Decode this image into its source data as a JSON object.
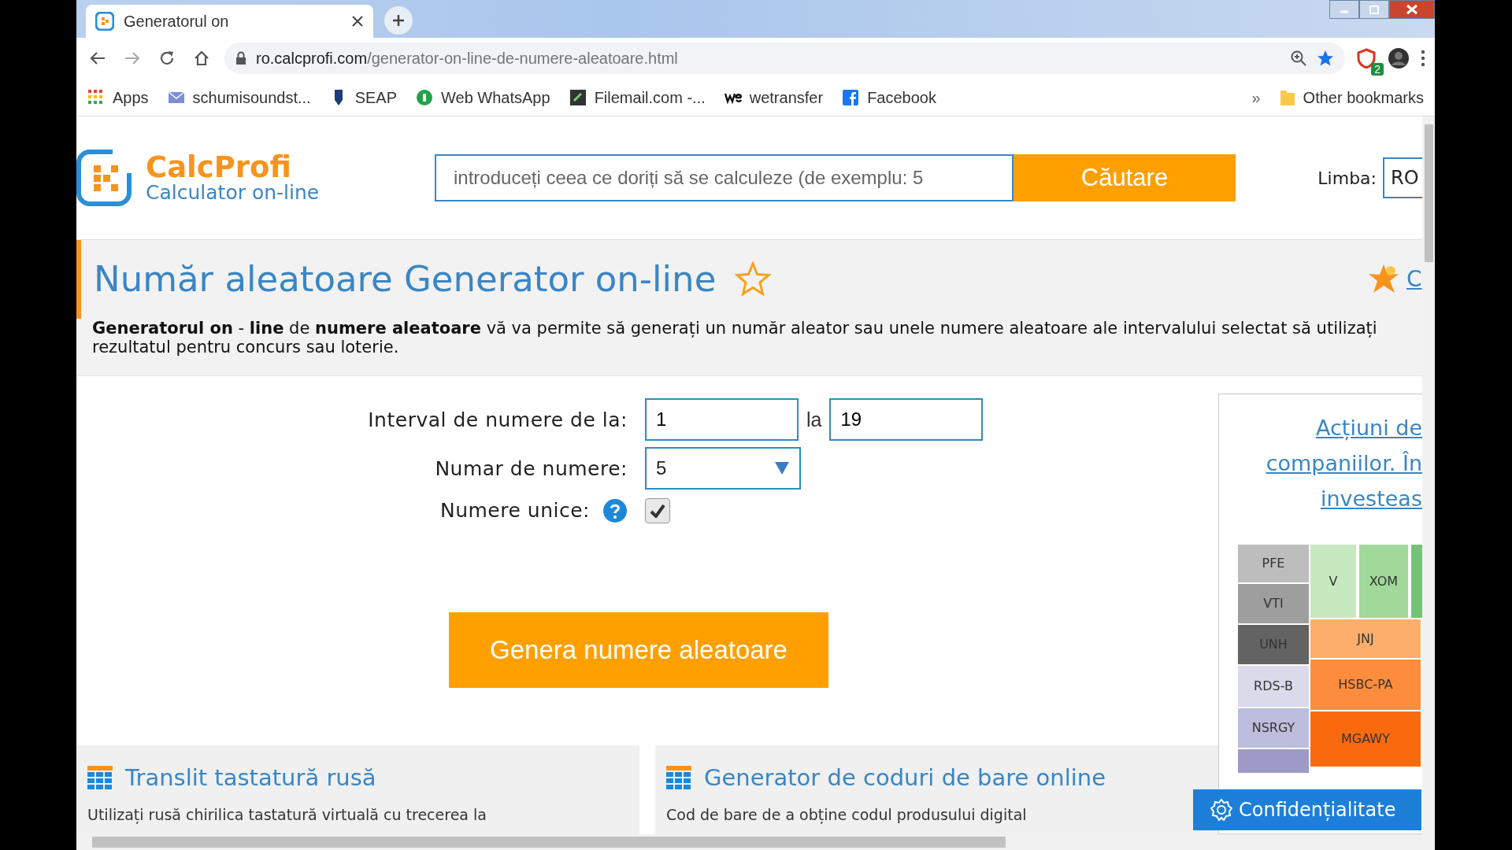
{
  "browser": {
    "tab": {
      "title": "Generatorul on"
    },
    "url": {
      "host": "ro.calcprofi.com",
      "path": "/generator-on-line-de-numere-aleatoare.html"
    },
    "bookmarks": [
      {
        "kind": "apps",
        "label": "Apps"
      },
      {
        "kind": "mail",
        "label": "schumisoundst..."
      },
      {
        "kind": "shield",
        "label": "SEAP"
      },
      {
        "kind": "whatsapp",
        "label": "Web WhatsApp"
      },
      {
        "kind": "filemail",
        "label": "Filemail.com -..."
      },
      {
        "kind": "we",
        "label": "wetransfer"
      },
      {
        "kind": "facebook",
        "label": "Facebook"
      }
    ],
    "more": "»",
    "other_bookmarks": "Other bookmarks",
    "extension_badge": "2"
  },
  "site": {
    "logo": {
      "name": "CalcProfi",
      "tagline": "Calculator on-line"
    },
    "search": {
      "placeholder": "introduceți ceea ce doriți să se calculeze (de exemplu: 5",
      "button": "Căutare"
    },
    "language": {
      "label": "Limba:",
      "value": "RO"
    }
  },
  "page": {
    "title": "Număr aleatoare Generator on-line",
    "corner_link": "C",
    "description": "**Generatorul on** - **line** de **numere aleatoare** vă va permite să generați un număr aleator sau unele numere aleatoare ale intervalului selectat să utilizați rezultatul pentru concurs sau loterie."
  },
  "form": {
    "range_label": "Interval de numere de la:",
    "from": "1",
    "separator": "la",
    "to": "19",
    "count_label": "Numar de numere:",
    "count": "5",
    "unique_label": "Numere unice:",
    "unique_checked": true,
    "generate_button": "Genera numere aleatoare"
  },
  "ad": {
    "link_lines": [
      "Acțiuni de",
      "companiilor. În",
      "investeas"
    ],
    "treemap_left": [
      {
        "label": "PFE",
        "color": "#bdbdbd"
      },
      {
        "label": "VTI",
        "color": "#9e9e9e"
      },
      {
        "label": "UNH",
        "color": "#636363"
      },
      {
        "label": "RDS-B",
        "color": "#dadaeb"
      },
      {
        "label": "NSRGY",
        "color": "#bcbddc"
      }
    ],
    "treemap_top": [
      {
        "label": "V",
        "color": "#c7e9c0"
      },
      {
        "label": "XOM",
        "color": "#a1d99b"
      }
    ],
    "treemap_right": [
      {
        "label": "JNJ",
        "color": "#fdae6b"
      },
      {
        "label": "HSBC-PA",
        "color": "#fd8d3c"
      },
      {
        "label": "MGAWY",
        "color": "#f96a0e"
      }
    ]
  },
  "related": [
    {
      "title": "Translit tastatură rusă",
      "text": "Utilizați rusă chirilica tastatură virtuală cu trecerea la"
    },
    {
      "title": "Generator de coduri de bare online",
      "text": "Cod de bare de a obține codul produsului digital"
    }
  ],
  "privacy_button": "Confidențialitate"
}
